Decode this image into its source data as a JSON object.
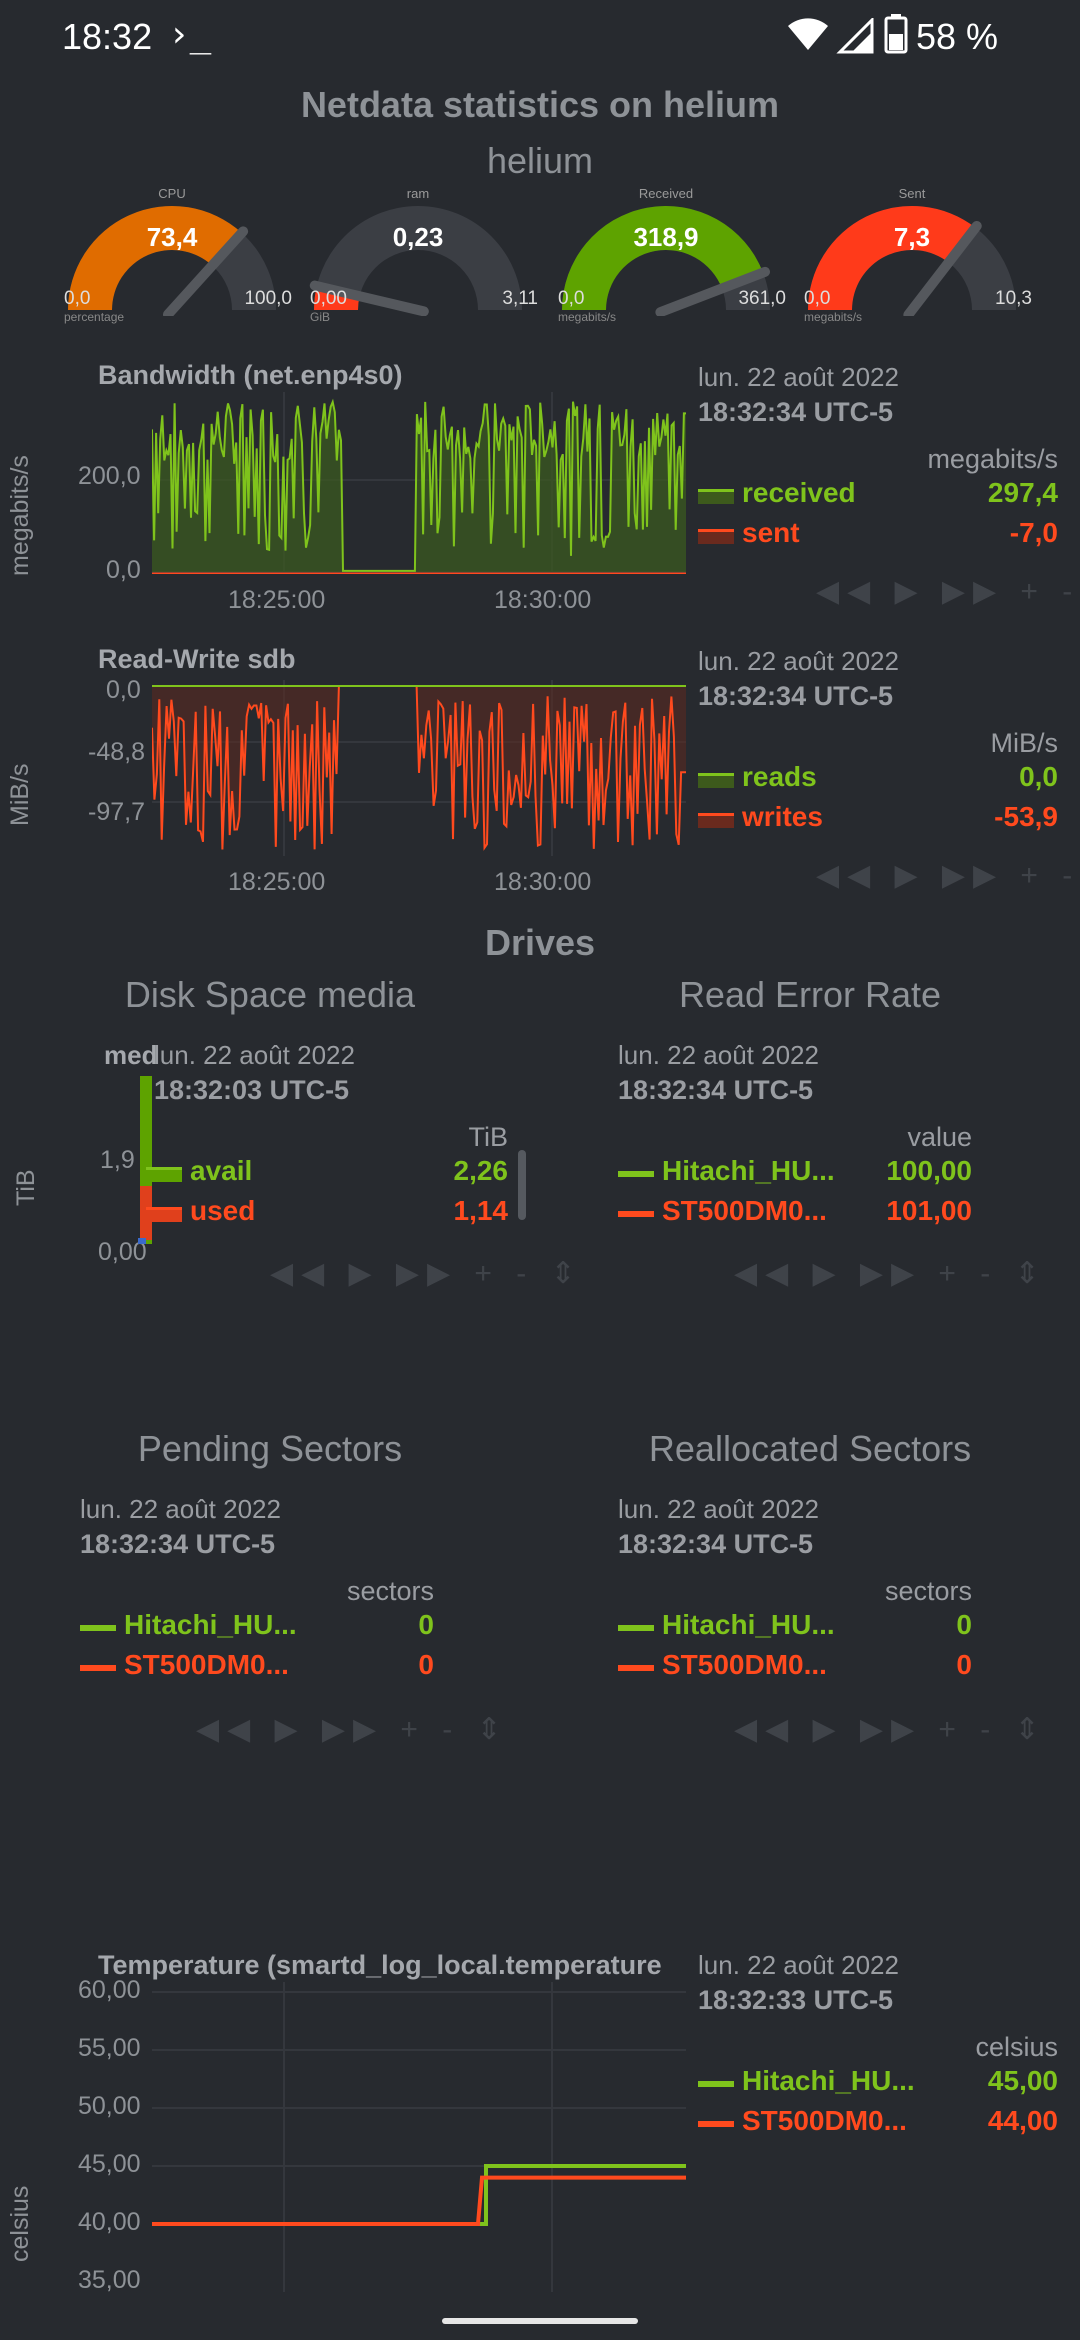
{
  "status_bar": {
    "time": "18:32",
    "terminal_glyph": "›_",
    "battery": "58 %",
    "icons": [
      "wifi-icon",
      "signal-icon",
      "battery-icon"
    ]
  },
  "header": {
    "title": "Netdata statistics on helium",
    "subtitle": "helium"
  },
  "gauges": [
    {
      "label": "CPU",
      "value": "73,4",
      "min": "0,0",
      "max": "100,0",
      "unit": "percentage",
      "fraction": 0.734,
      "color": "#e06c00"
    },
    {
      "label": "ram",
      "value": "0,23",
      "min": "0,00",
      "max": "3,11",
      "unit": "GiB",
      "fraction": 0.074,
      "color": "#ff3a1a"
    },
    {
      "label": "Received",
      "value": "318,9",
      "min": "0,0",
      "max": "361,0",
      "unit": "megabits/s",
      "fraction": 0.883,
      "color": "#5ea300"
    },
    {
      "label": "Sent",
      "value": "7,3",
      "min": "0,0",
      "max": "10,3",
      "unit": "megabits/s",
      "fraction": 0.709,
      "color": "#ff3a1a"
    }
  ],
  "bandwidth": {
    "title": "Bandwidth (net.enp4s0)",
    "ylabel": "megabits/s",
    "yticks": [
      "200,0",
      "0,0"
    ],
    "xticks": [
      "18:25:00",
      "18:30:00"
    ],
    "legend": {
      "date": "lun. 22 août 2022",
      "time": "18:32:34 UTC-5",
      "unit": "megabits/s",
      "rows": [
        {
          "name": "received",
          "value": "297,4",
          "color": "#7fc31c"
        },
        {
          "name": "sent",
          "value": "-7,0",
          "color": "#ff4a1e"
        }
      ]
    }
  },
  "readwrite": {
    "title": "Read-Write sdb",
    "ylabel": "MiB/s",
    "yticks": [
      "0,0",
      "-48,8",
      "-97,7"
    ],
    "xticks": [
      "18:25:00",
      "18:30:00"
    ],
    "legend": {
      "date": "lun. 22 août 2022",
      "time": "18:32:34 UTC-5",
      "unit": "MiB/s",
      "rows": [
        {
          "name": "reads",
          "value": "0,0",
          "color": "#7fc31c"
        },
        {
          "name": "writes",
          "value": "-53,9",
          "color": "#ff4a1e"
        }
      ]
    }
  },
  "drives": {
    "section_title": "Drives",
    "disk_space": {
      "title": "Disk Space media",
      "chart_title_fragment": "med",
      "ylabel": "TiB",
      "yticks": [
        "1,9",
        "0,00"
      ],
      "legend": {
        "date": "lun. 22 août 2022",
        "time": "18:32:03 UTC-5",
        "unit": "TiB",
        "rows": [
          {
            "name": "avail",
            "value": "2,26",
            "color": "#7fc31c"
          },
          {
            "name": "used",
            "value": "1,14",
            "color": "#ff4a1e"
          }
        ]
      }
    },
    "read_error_rate": {
      "title": "Read Error Rate",
      "legend": {
        "date": "lun. 22 août 2022",
        "time": "18:32:34 UTC-5",
        "unit": "value",
        "rows": [
          {
            "name": "Hitachi_HU...",
            "value": "100,00",
            "color": "#7fc31c"
          },
          {
            "name": "ST500DM0...",
            "value": "101,00",
            "color": "#ff4a1e"
          }
        ]
      }
    },
    "pending_sectors": {
      "title": "Pending Sectors",
      "legend": {
        "date": "lun. 22 août 2022",
        "time": "18:32:34 UTC-5",
        "unit": "sectors",
        "rows": [
          {
            "name": "Hitachi_HU...",
            "value": "0",
            "color": "#7fc31c"
          },
          {
            "name": "ST500DM0...",
            "value": "0",
            "color": "#ff4a1e"
          }
        ]
      }
    },
    "reallocated_sectors": {
      "title": "Reallocated Sectors",
      "legend": {
        "date": "lun. 22 août 2022",
        "time": "18:32:34 UTC-5",
        "unit": "sectors",
        "rows": [
          {
            "name": "Hitachi_HU...",
            "value": "0",
            "color": "#7fc31c"
          },
          {
            "name": "ST500DM0...",
            "value": "0",
            "color": "#ff4a1e"
          }
        ]
      }
    }
  },
  "temperature": {
    "title": "Temperature (smartd_log_local.temperature",
    "ylabel": "celsius",
    "yticks": [
      "60,00",
      "55,00",
      "50,00",
      "45,00",
      "40,00",
      "35,00"
    ],
    "legend": {
      "date": "lun. 22 août 2022",
      "time": "18:32:33 UTC-5",
      "unit": "celsius",
      "rows": [
        {
          "name": "Hitachi_HU...",
          "value": "45,00",
          "color": "#7fc31c"
        },
        {
          "name": "ST500DM0...",
          "value": "44,00",
          "color": "#ff4a1e"
        }
      ]
    }
  },
  "toolbar_glyphs": "◀◀ ▶ ▶▶ + - ⇕",
  "chart_data": [
    {
      "type": "area",
      "title": "Bandwidth (net.enp4s0)",
      "ylabel": "megabits/s",
      "ylim": [
        0,
        300
      ],
      "x": [
        "18:22:40",
        "18:32:34"
      ],
      "series": [
        {
          "name": "received",
          "pattern": "active 18:22:40-18:26:20, idle 18:26:20-18:27:35, active 18:27:35-18:32:34",
          "peak": 320,
          "last": 297.4
        },
        {
          "name": "sent",
          "peak": -7,
          "last": -7.0
        }
      ]
    },
    {
      "type": "area",
      "title": "Read-Write sdb",
      "ylabel": "MiB/s",
      "ylim": [
        -105,
        0
      ],
      "series": [
        {
          "name": "reads",
          "last": 0.0
        },
        {
          "name": "writes",
          "min": -103,
          "last": -53.9
        }
      ]
    },
    {
      "type": "line",
      "title": "Temperature (smartd_log_local.temperature",
      "ylabel": "celsius",
      "ylim": [
        35,
        60
      ],
      "series": [
        {
          "name": "Hitachi_HU...",
          "values_before": 40,
          "values_after": 45,
          "last": 45.0
        },
        {
          "name": "ST500DM0...",
          "values_before": 40,
          "values_after": 44,
          "last": 44.0
        }
      ]
    }
  ]
}
